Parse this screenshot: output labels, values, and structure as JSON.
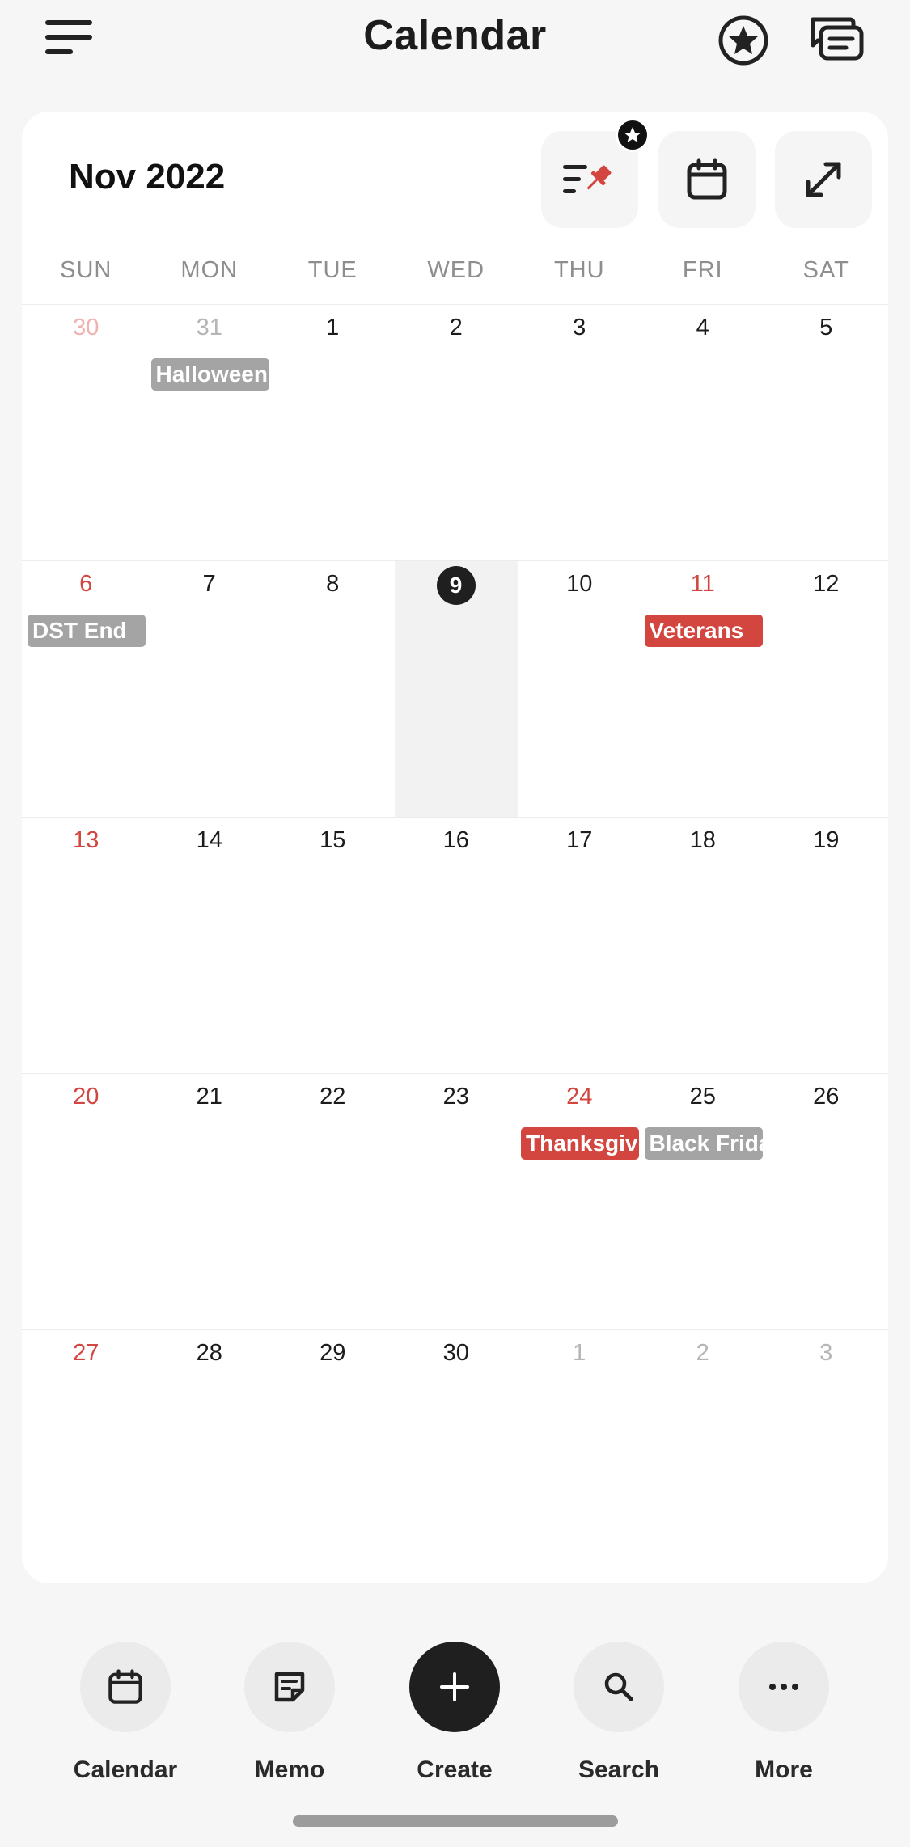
{
  "header": {
    "title": "Calendar"
  },
  "calendar": {
    "month_title": "Nov 2022",
    "weekdays": [
      "SUN",
      "MON",
      "TUE",
      "WED",
      "THU",
      "FRI",
      "SAT"
    ],
    "weeks": [
      [
        {
          "day": "30",
          "muted": true,
          "sunday": true
        },
        {
          "day": "31",
          "muted": true,
          "event": {
            "label": "Halloween",
            "color": "gray"
          }
        },
        {
          "day": "1"
        },
        {
          "day": "2"
        },
        {
          "day": "3"
        },
        {
          "day": "4"
        },
        {
          "day": "5"
        }
      ],
      [
        {
          "day": "6",
          "sunday": true,
          "event": {
            "label": "DST End",
            "color": "gray"
          }
        },
        {
          "day": "7"
        },
        {
          "day": "8"
        },
        {
          "day": "9",
          "today": true
        },
        {
          "day": "10"
        },
        {
          "day": "11",
          "holiday": true,
          "event": {
            "label": "Veterans",
            "color": "red"
          }
        },
        {
          "day": "12"
        }
      ],
      [
        {
          "day": "13",
          "sunday": true
        },
        {
          "day": "14"
        },
        {
          "day": "15"
        },
        {
          "day": "16"
        },
        {
          "day": "17"
        },
        {
          "day": "18"
        },
        {
          "day": "19"
        }
      ],
      [
        {
          "day": "20",
          "sunday": true
        },
        {
          "day": "21"
        },
        {
          "day": "22"
        },
        {
          "day": "23"
        },
        {
          "day": "24",
          "holiday": true,
          "event": {
            "label": "Thanksgiving",
            "color": "red"
          }
        },
        {
          "day": "25",
          "event": {
            "label": "Black Friday",
            "color": "gray"
          }
        },
        {
          "day": "26"
        }
      ],
      [
        {
          "day": "27",
          "sunday": true
        },
        {
          "day": "28"
        },
        {
          "day": "29"
        },
        {
          "day": "30"
        },
        {
          "day": "1",
          "muted": true
        },
        {
          "day": "2",
          "muted": true
        },
        {
          "day": "3",
          "muted": true
        }
      ]
    ]
  },
  "nav": {
    "calendar": "Calendar",
    "memo": "Memo",
    "create": "Create",
    "search": "Search",
    "more": "More"
  },
  "colors": {
    "accent_red": "#d3453f",
    "event_gray": "#a4a4a4",
    "today_bg": "#1f1f1f"
  },
  "icons": {
    "menu": "menu-icon",
    "star": "star-circle-icon",
    "chat": "chat-bubbles-icon",
    "pin_list": "pinned-list-icon",
    "calendar": "calendar-icon",
    "expand": "expand-icon",
    "memo": "memo-icon",
    "create": "plus-icon",
    "search": "search-icon",
    "more": "more-dots-icon"
  }
}
